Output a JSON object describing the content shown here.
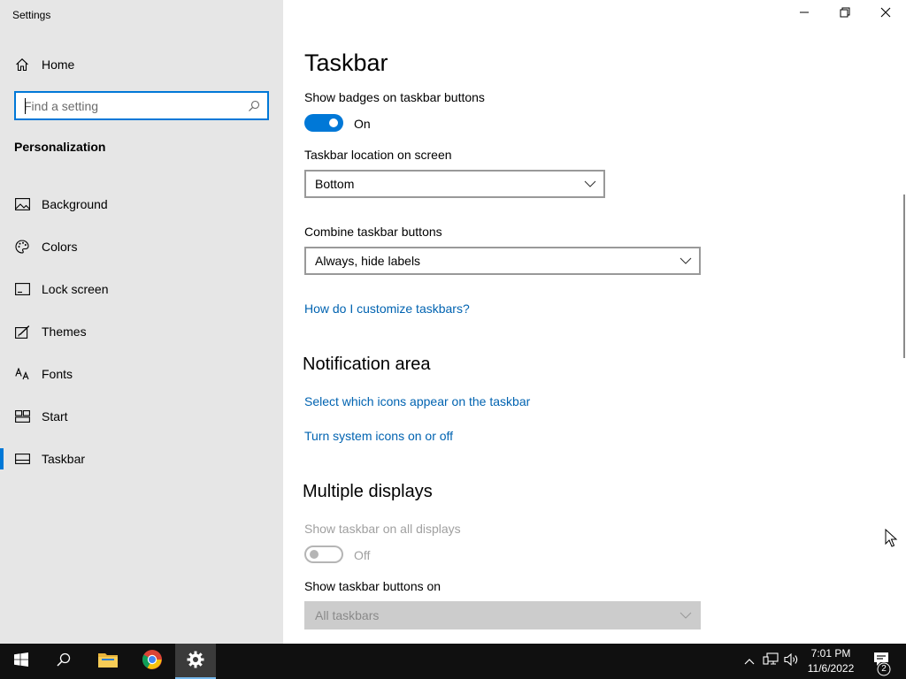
{
  "window": {
    "title": "Settings",
    "controls": {
      "minimize": "minimize-icon",
      "restore": "restore-icon",
      "close": "close-icon"
    }
  },
  "sidebar": {
    "home_label": "Home",
    "search_placeholder": "Find a setting",
    "section_title": "Personalization",
    "items": [
      {
        "label": "Background",
        "icon": "picture-icon"
      },
      {
        "label": "Colors",
        "icon": "palette-icon"
      },
      {
        "label": "Lock screen",
        "icon": "lock-screen-icon"
      },
      {
        "label": "Themes",
        "icon": "brush-icon"
      },
      {
        "label": "Fonts",
        "icon": "fonts-icon"
      },
      {
        "label": "Start",
        "icon": "start-tiles-icon"
      },
      {
        "label": "Taskbar",
        "icon": "taskbar-icon",
        "selected": true
      }
    ]
  },
  "main": {
    "page_title": "Taskbar",
    "badges": {
      "label": "Show badges on taskbar buttons",
      "state": "On"
    },
    "location": {
      "label": "Taskbar location on screen",
      "value": "Bottom"
    },
    "combine": {
      "label": "Combine taskbar buttons",
      "value": "Always, hide labels"
    },
    "customize_link": "How do I customize taskbars?",
    "notification_area": {
      "heading": "Notification area",
      "link_icons": "Select which icons appear on the taskbar",
      "link_system": "Turn system icons on or off"
    },
    "multiple_displays": {
      "heading": "Multiple displays",
      "show_all_label": "Show taskbar on all displays",
      "show_all_state": "Off",
      "buttons_on_label": "Show taskbar buttons on",
      "buttons_on_value": "All taskbars"
    }
  },
  "taskbar": {
    "clock_time": "7:01 PM",
    "clock_date": "11/6/2022",
    "notification_count": "2",
    "colors": {
      "accent": "#0078d7",
      "link": "#0063b1",
      "taskbar_bg": "#101010"
    }
  }
}
